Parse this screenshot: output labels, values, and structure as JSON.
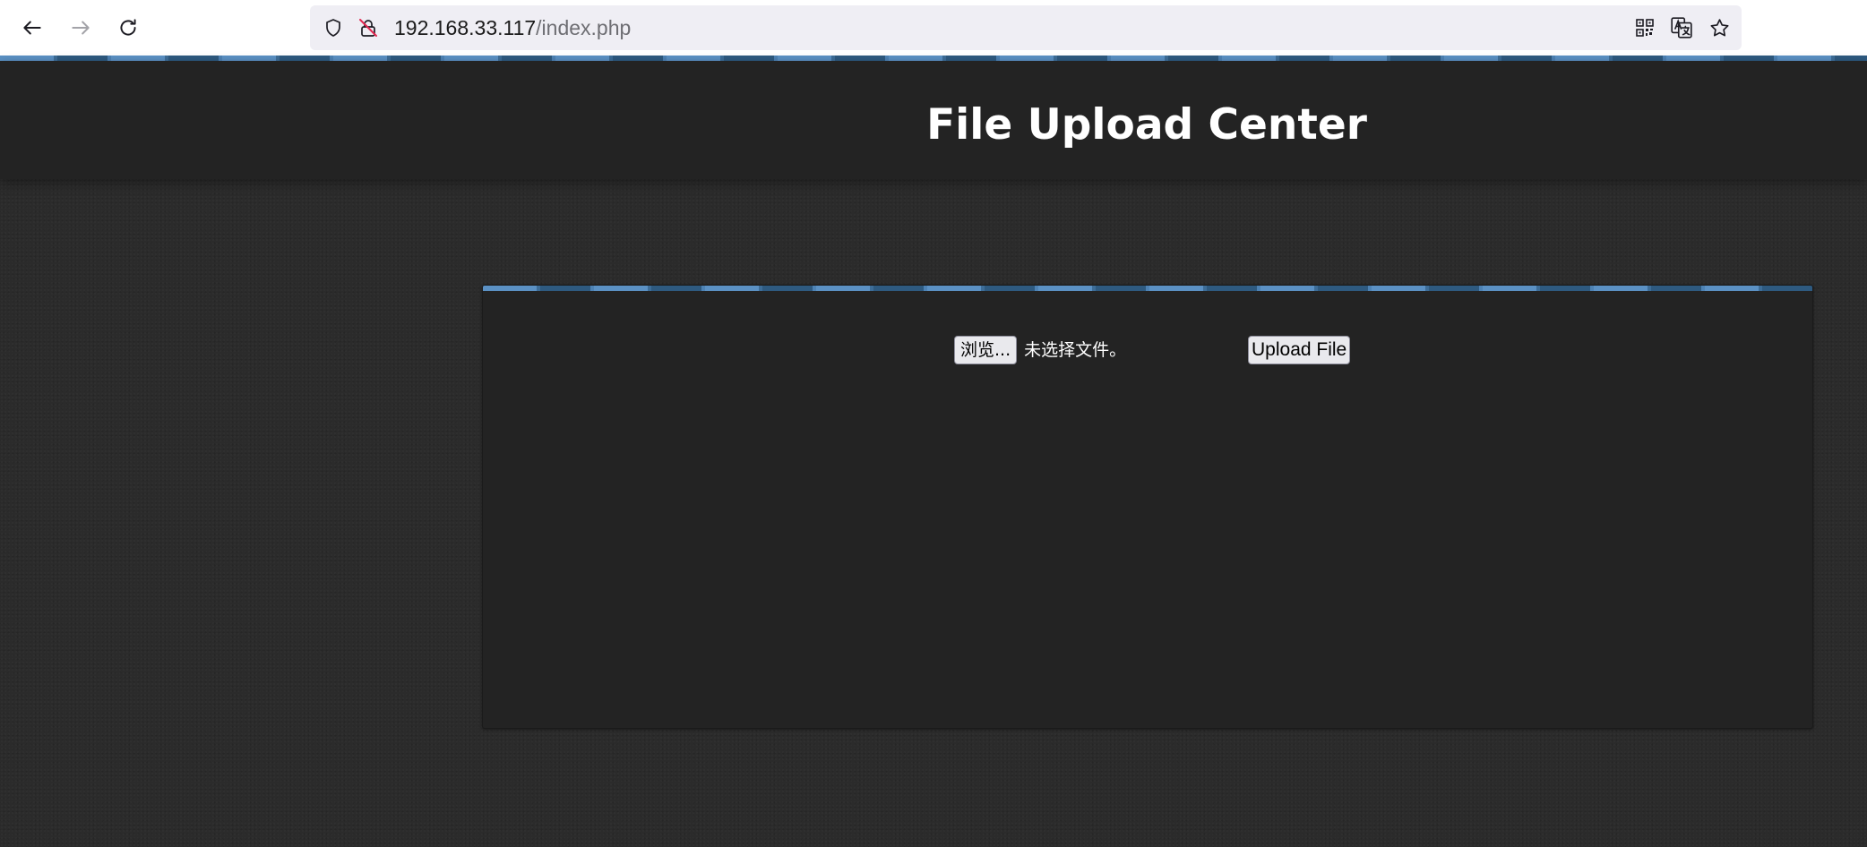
{
  "browser": {
    "url_host": "192.168.33.117",
    "url_path": "/index.php",
    "icons": {
      "back": "back-arrow-icon",
      "forward": "forward-arrow-icon",
      "reload": "reload-icon",
      "tracking": "shield-icon",
      "security": "insecure-lock-icon",
      "qr": "qr-code-icon",
      "translate": "translate-icon",
      "bookmark": "star-icon"
    }
  },
  "header": {
    "title": "File Upload Center"
  },
  "upload_form": {
    "browse_label": "浏览...",
    "file_status": "未选择文件。",
    "submit_label": "Upload File"
  },
  "colors": {
    "accent_stripe": "#5b91c4",
    "page_background": "#2b2b2b",
    "panel_background": "#232323"
  }
}
